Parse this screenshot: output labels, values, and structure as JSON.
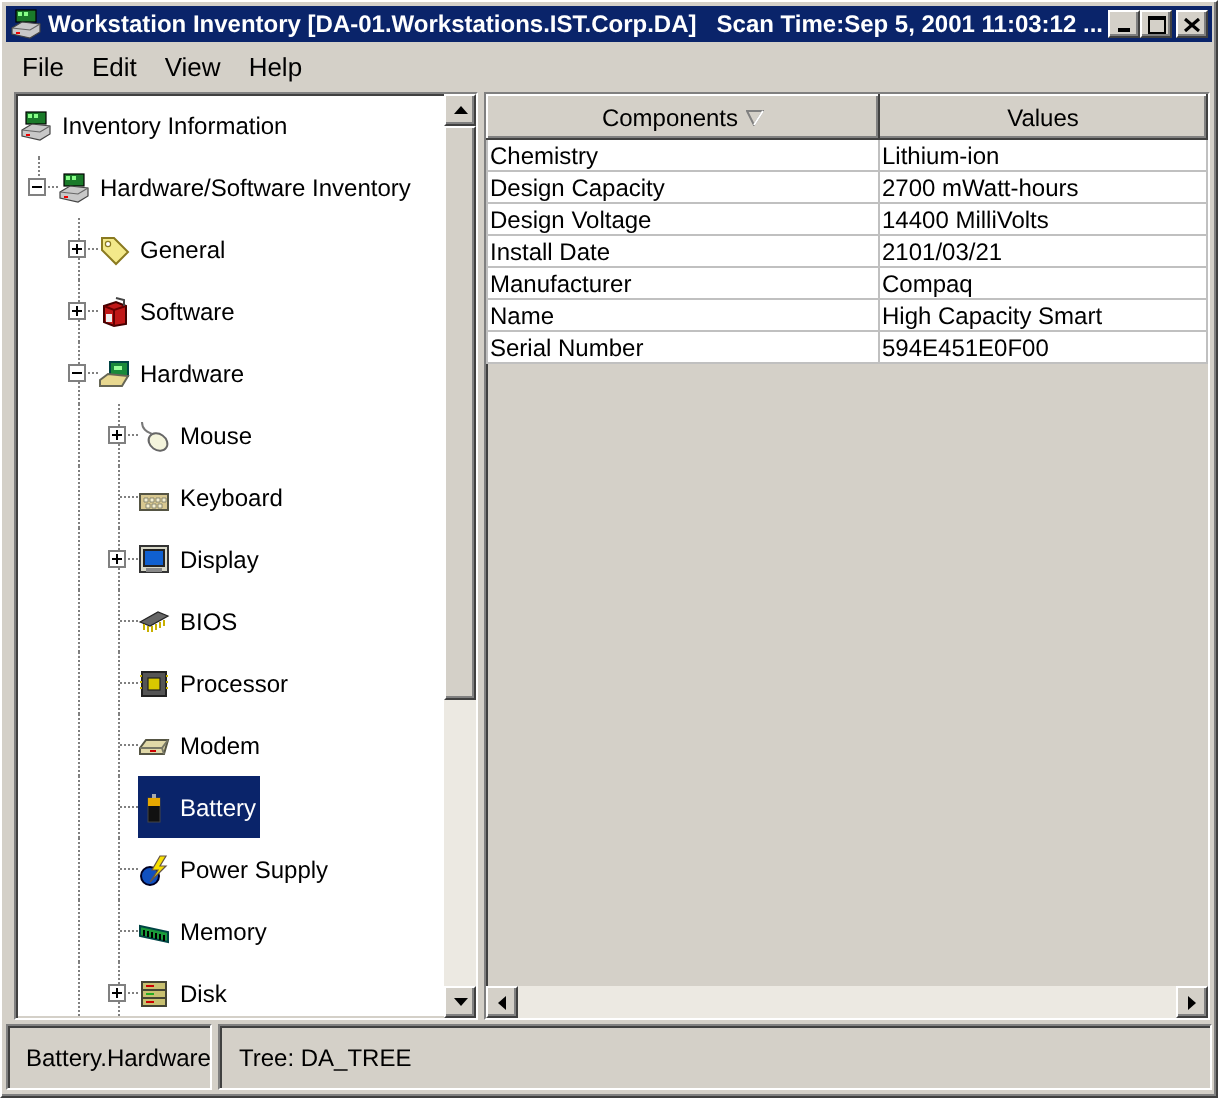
{
  "window": {
    "title": "Workstation Inventory [DA-01.Workstations.IST.Corp.DA]   Scan Time:Sep 5, 2001 11:03:12 ..."
  },
  "menu": [
    "File",
    "Edit",
    "View",
    "Help"
  ],
  "tree": [
    {
      "label": "Inventory Information",
      "selected": false,
      "children": [
        {
          "label": "Hardware/Software Inventory",
          "kind": "branch",
          "expanded": true,
          "selected": false,
          "children": [
            {
              "label": "General",
              "kind": "branch",
              "expanded": false,
              "selected": false
            },
            {
              "label": "Software",
              "kind": "branch",
              "expanded": false,
              "selected": false
            },
            {
              "label": "Hardware",
              "kind": "branch",
              "expanded": true,
              "selected": false,
              "children": [
                {
                  "label": "Mouse",
                  "kind": "branch",
                  "expanded": false,
                  "selected": false
                },
                {
                  "label": "Keyboard",
                  "kind": "leaf",
                  "selected": false
                },
                {
                  "label": "Display",
                  "kind": "branch",
                  "expanded": false,
                  "selected": false
                },
                {
                  "label": "BIOS",
                  "kind": "leaf",
                  "selected": false
                },
                {
                  "label": "Processor",
                  "kind": "leaf",
                  "selected": false
                },
                {
                  "label": "Modem",
                  "kind": "leaf",
                  "selected": false
                },
                {
                  "label": "Battery",
                  "kind": "leaf",
                  "selected": true
                },
                {
                  "label": "Power Supply",
                  "kind": "leaf",
                  "selected": false
                },
                {
                  "label": "Memory",
                  "kind": "leaf",
                  "selected": false
                },
                {
                  "label": "Disk",
                  "kind": "branch",
                  "expanded": false,
                  "selected": false
                }
              ]
            }
          ]
        }
      ]
    }
  ],
  "table": {
    "columns": [
      "Components",
      "Values"
    ],
    "rows": [
      [
        "Chemistry",
        "Lithium-ion"
      ],
      [
        "Design Capacity",
        "2700 mWatt-hours"
      ],
      [
        "Design Voltage",
        "14400 MilliVolts"
      ],
      [
        "Install Date",
        "2101/03/21"
      ],
      [
        "Manufacturer",
        "Compaq"
      ],
      [
        "Name",
        "High Capacity Smart"
      ],
      [
        "Serial Number",
        "594E451E0F00"
      ]
    ]
  },
  "status_bar": [
    "Battery.Hardware",
    "Tree: DA_TREE"
  ]
}
